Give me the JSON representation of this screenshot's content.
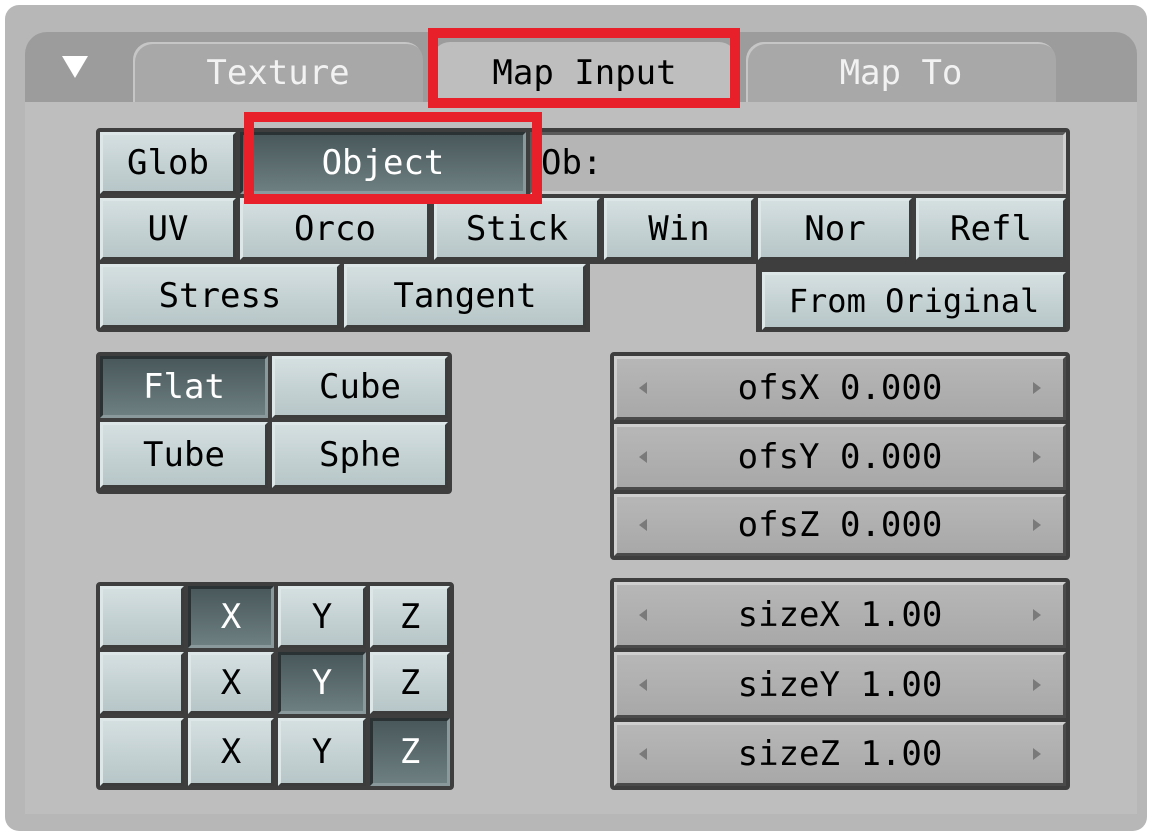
{
  "tabs": [
    {
      "label": "Texture"
    },
    {
      "label": "Map Input",
      "active": true
    },
    {
      "label": "Map To"
    }
  ],
  "coord_row1": {
    "glob": "Glob",
    "object": "Object",
    "ob_field_label": "Ob:",
    "ob_field_value": ""
  },
  "coord_row2": [
    "UV",
    "Orco",
    "Stick",
    "Win",
    "Nor",
    "Refl"
  ],
  "coord_row3": {
    "stress": "Stress",
    "tangent": "Tangent",
    "from_original": "From Original"
  },
  "projection": {
    "flat": "Flat",
    "cube": "Cube",
    "tube": "Tube",
    "sphe": "Sphe",
    "selected": "Flat"
  },
  "axis_mapping": {
    "rows": [
      {
        "empty": "",
        "x": "X",
        "y": "Y",
        "z": "Z",
        "selected": "x"
      },
      {
        "empty": "",
        "x": "X",
        "y": "Y",
        "z": "Z",
        "selected": "y"
      },
      {
        "empty": "",
        "x": "X",
        "y": "Y",
        "z": "Z",
        "selected": "z"
      }
    ]
  },
  "offset": {
    "x": "ofsX 0.000",
    "y": "ofsY 0.000",
    "z": "ofsZ 0.000"
  },
  "size": {
    "x": "sizeX 1.00",
    "y": "sizeY 1.00",
    "z": "sizeZ 1.00"
  },
  "colors": {
    "highlight": "#e8202a",
    "selected_button": "#566769",
    "button": "#c5d2d4"
  }
}
